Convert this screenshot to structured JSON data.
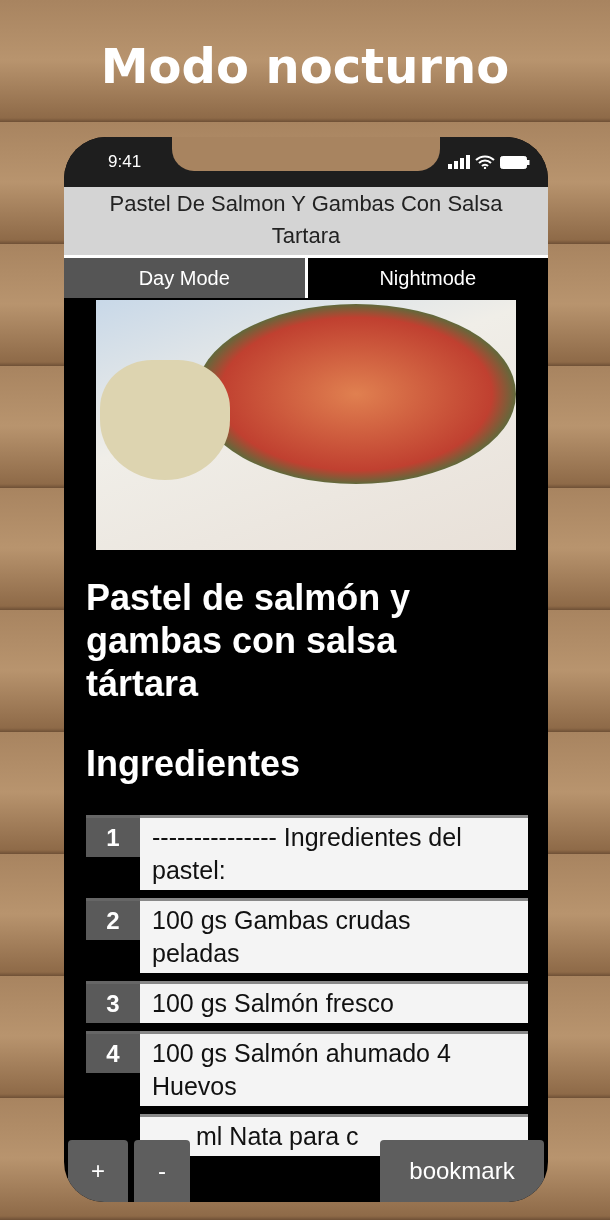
{
  "banner": {
    "title": "Modo nocturno"
  },
  "status_bar": {
    "time": "9:41"
  },
  "app_title": "Pastel De Salmon Y Gambas Con Salsa Tartara",
  "tabs": [
    {
      "label": "Day Mode",
      "selected": false
    },
    {
      "label": "Nightmode",
      "selected": true
    }
  ],
  "recipe": {
    "title": "Pastel de salmón y gambas con salsa tártara",
    "section": "Ingredientes"
  },
  "ingredients": [
    {
      "number": "1",
      "text": "--------------- Ingredientes del pastel:"
    },
    {
      "number": "2",
      "text": "100 gs Gambas crudas peladas"
    },
    {
      "number": "3",
      "text": "100 gs Salmón fresco"
    },
    {
      "number": "4",
      "text": "100 gs Salmón ahumado 4 Huevos"
    },
    {
      "text": "ml Nata para c"
    }
  ],
  "bottom_buttons": [
    {
      "label": "+"
    },
    {
      "label": "-"
    },
    {
      "label": "bookmark"
    }
  ]
}
